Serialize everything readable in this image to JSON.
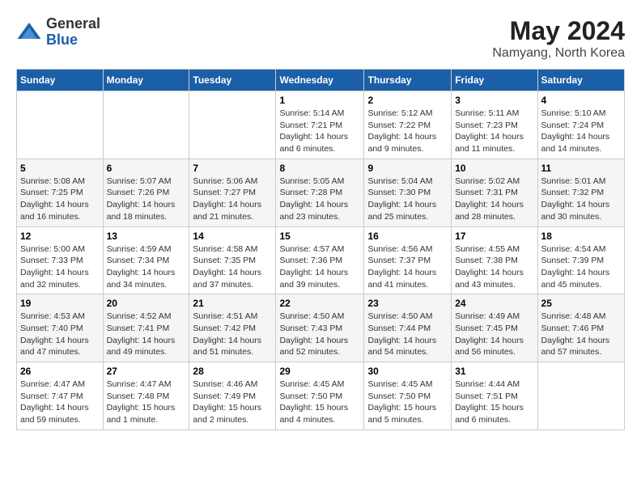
{
  "header": {
    "logo_general": "General",
    "logo_blue": "Blue",
    "title": "May 2024",
    "subtitle": "Namyang, North Korea"
  },
  "days_of_week": [
    "Sunday",
    "Monday",
    "Tuesday",
    "Wednesday",
    "Thursday",
    "Friday",
    "Saturday"
  ],
  "weeks": [
    [
      {
        "day": "",
        "sunrise": "",
        "sunset": "",
        "daylight": ""
      },
      {
        "day": "",
        "sunrise": "",
        "sunset": "",
        "daylight": ""
      },
      {
        "day": "",
        "sunrise": "",
        "sunset": "",
        "daylight": ""
      },
      {
        "day": "1",
        "sunrise": "Sunrise: 5:14 AM",
        "sunset": "Sunset: 7:21 PM",
        "daylight": "Daylight: 14 hours and 6 minutes."
      },
      {
        "day": "2",
        "sunrise": "Sunrise: 5:12 AM",
        "sunset": "Sunset: 7:22 PM",
        "daylight": "Daylight: 14 hours and 9 minutes."
      },
      {
        "day": "3",
        "sunrise": "Sunrise: 5:11 AM",
        "sunset": "Sunset: 7:23 PM",
        "daylight": "Daylight: 14 hours and 11 minutes."
      },
      {
        "day": "4",
        "sunrise": "Sunrise: 5:10 AM",
        "sunset": "Sunset: 7:24 PM",
        "daylight": "Daylight: 14 hours and 14 minutes."
      }
    ],
    [
      {
        "day": "5",
        "sunrise": "Sunrise: 5:08 AM",
        "sunset": "Sunset: 7:25 PM",
        "daylight": "Daylight: 14 hours and 16 minutes."
      },
      {
        "day": "6",
        "sunrise": "Sunrise: 5:07 AM",
        "sunset": "Sunset: 7:26 PM",
        "daylight": "Daylight: 14 hours and 18 minutes."
      },
      {
        "day": "7",
        "sunrise": "Sunrise: 5:06 AM",
        "sunset": "Sunset: 7:27 PM",
        "daylight": "Daylight: 14 hours and 21 minutes."
      },
      {
        "day": "8",
        "sunrise": "Sunrise: 5:05 AM",
        "sunset": "Sunset: 7:28 PM",
        "daylight": "Daylight: 14 hours and 23 minutes."
      },
      {
        "day": "9",
        "sunrise": "Sunrise: 5:04 AM",
        "sunset": "Sunset: 7:30 PM",
        "daylight": "Daylight: 14 hours and 25 minutes."
      },
      {
        "day": "10",
        "sunrise": "Sunrise: 5:02 AM",
        "sunset": "Sunset: 7:31 PM",
        "daylight": "Daylight: 14 hours and 28 minutes."
      },
      {
        "day": "11",
        "sunrise": "Sunrise: 5:01 AM",
        "sunset": "Sunset: 7:32 PM",
        "daylight": "Daylight: 14 hours and 30 minutes."
      }
    ],
    [
      {
        "day": "12",
        "sunrise": "Sunrise: 5:00 AM",
        "sunset": "Sunset: 7:33 PM",
        "daylight": "Daylight: 14 hours and 32 minutes."
      },
      {
        "day": "13",
        "sunrise": "Sunrise: 4:59 AM",
        "sunset": "Sunset: 7:34 PM",
        "daylight": "Daylight: 14 hours and 34 minutes."
      },
      {
        "day": "14",
        "sunrise": "Sunrise: 4:58 AM",
        "sunset": "Sunset: 7:35 PM",
        "daylight": "Daylight: 14 hours and 37 minutes."
      },
      {
        "day": "15",
        "sunrise": "Sunrise: 4:57 AM",
        "sunset": "Sunset: 7:36 PM",
        "daylight": "Daylight: 14 hours and 39 minutes."
      },
      {
        "day": "16",
        "sunrise": "Sunrise: 4:56 AM",
        "sunset": "Sunset: 7:37 PM",
        "daylight": "Daylight: 14 hours and 41 minutes."
      },
      {
        "day": "17",
        "sunrise": "Sunrise: 4:55 AM",
        "sunset": "Sunset: 7:38 PM",
        "daylight": "Daylight: 14 hours and 43 minutes."
      },
      {
        "day": "18",
        "sunrise": "Sunrise: 4:54 AM",
        "sunset": "Sunset: 7:39 PM",
        "daylight": "Daylight: 14 hours and 45 minutes."
      }
    ],
    [
      {
        "day": "19",
        "sunrise": "Sunrise: 4:53 AM",
        "sunset": "Sunset: 7:40 PM",
        "daylight": "Daylight: 14 hours and 47 minutes."
      },
      {
        "day": "20",
        "sunrise": "Sunrise: 4:52 AM",
        "sunset": "Sunset: 7:41 PM",
        "daylight": "Daylight: 14 hours and 49 minutes."
      },
      {
        "day": "21",
        "sunrise": "Sunrise: 4:51 AM",
        "sunset": "Sunset: 7:42 PM",
        "daylight": "Daylight: 14 hours and 51 minutes."
      },
      {
        "day": "22",
        "sunrise": "Sunrise: 4:50 AM",
        "sunset": "Sunset: 7:43 PM",
        "daylight": "Daylight: 14 hours and 52 minutes."
      },
      {
        "day": "23",
        "sunrise": "Sunrise: 4:50 AM",
        "sunset": "Sunset: 7:44 PM",
        "daylight": "Daylight: 14 hours and 54 minutes."
      },
      {
        "day": "24",
        "sunrise": "Sunrise: 4:49 AM",
        "sunset": "Sunset: 7:45 PM",
        "daylight": "Daylight: 14 hours and 56 minutes."
      },
      {
        "day": "25",
        "sunrise": "Sunrise: 4:48 AM",
        "sunset": "Sunset: 7:46 PM",
        "daylight": "Daylight: 14 hours and 57 minutes."
      }
    ],
    [
      {
        "day": "26",
        "sunrise": "Sunrise: 4:47 AM",
        "sunset": "Sunset: 7:47 PM",
        "daylight": "Daylight: 14 hours and 59 minutes."
      },
      {
        "day": "27",
        "sunrise": "Sunrise: 4:47 AM",
        "sunset": "Sunset: 7:48 PM",
        "daylight": "Daylight: 15 hours and 1 minute."
      },
      {
        "day": "28",
        "sunrise": "Sunrise: 4:46 AM",
        "sunset": "Sunset: 7:49 PM",
        "daylight": "Daylight: 15 hours and 2 minutes."
      },
      {
        "day": "29",
        "sunrise": "Sunrise: 4:45 AM",
        "sunset": "Sunset: 7:50 PM",
        "daylight": "Daylight: 15 hours and 4 minutes."
      },
      {
        "day": "30",
        "sunrise": "Sunrise: 4:45 AM",
        "sunset": "Sunset: 7:50 PM",
        "daylight": "Daylight: 15 hours and 5 minutes."
      },
      {
        "day": "31",
        "sunrise": "Sunrise: 4:44 AM",
        "sunset": "Sunset: 7:51 PM",
        "daylight": "Daylight: 15 hours and 6 minutes."
      },
      {
        "day": "",
        "sunrise": "",
        "sunset": "",
        "daylight": ""
      }
    ]
  ]
}
